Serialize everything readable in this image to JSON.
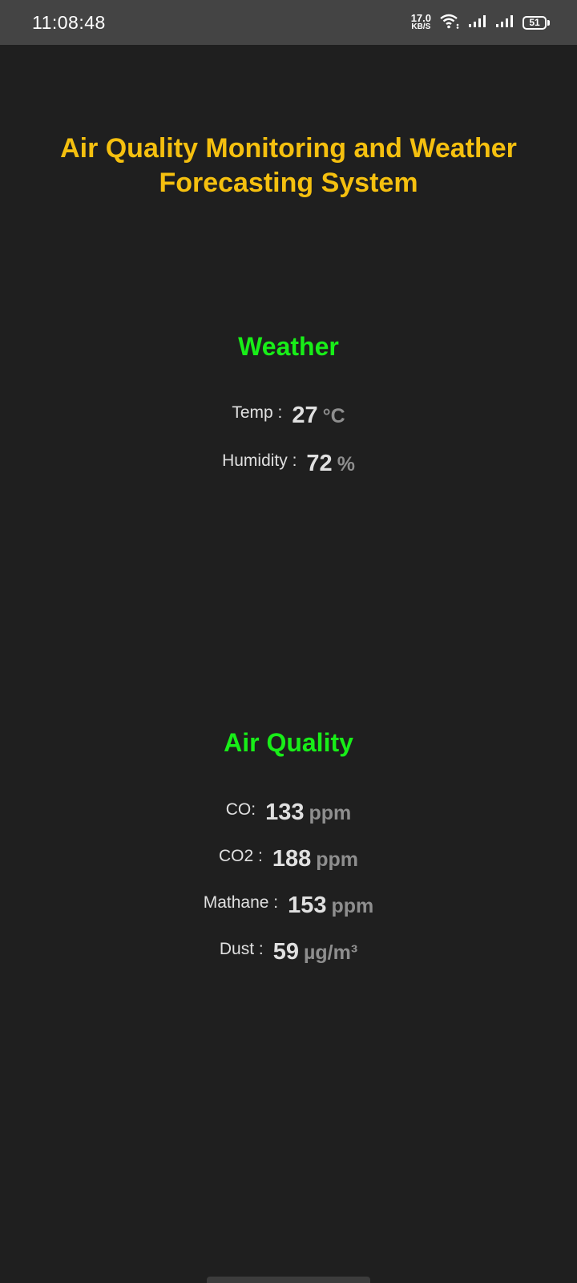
{
  "status_bar": {
    "time": "11:08:48",
    "net_speed": "17.0",
    "net_unit": "KB/S",
    "battery": "51",
    "icons": [
      "wifi-icon",
      "signal-icon",
      "signal-icon",
      "battery-icon"
    ]
  },
  "app": {
    "title": "Air Quality Monitoring and Weather Forecasting System",
    "title_color": "#f5c00f",
    "section_color": "#18ee18"
  },
  "weather": {
    "title": "Weather",
    "temp": {
      "label": "Temp :",
      "value": "27",
      "unit": "°C"
    },
    "humidity": {
      "label": "Humidity :",
      "value": "72",
      "unit": "%"
    }
  },
  "air_quality": {
    "title": "Air Quality",
    "co": {
      "label": "CO:",
      "value": "133",
      "unit": "ppm"
    },
    "co2": {
      "label": "CO2 :",
      "value": "188",
      "unit": "ppm"
    },
    "methane": {
      "label": "Mathane :",
      "value": "153",
      "unit": "ppm"
    },
    "dust": {
      "label": "Dust :",
      "value": "59",
      "unit": "µg/m³"
    }
  }
}
